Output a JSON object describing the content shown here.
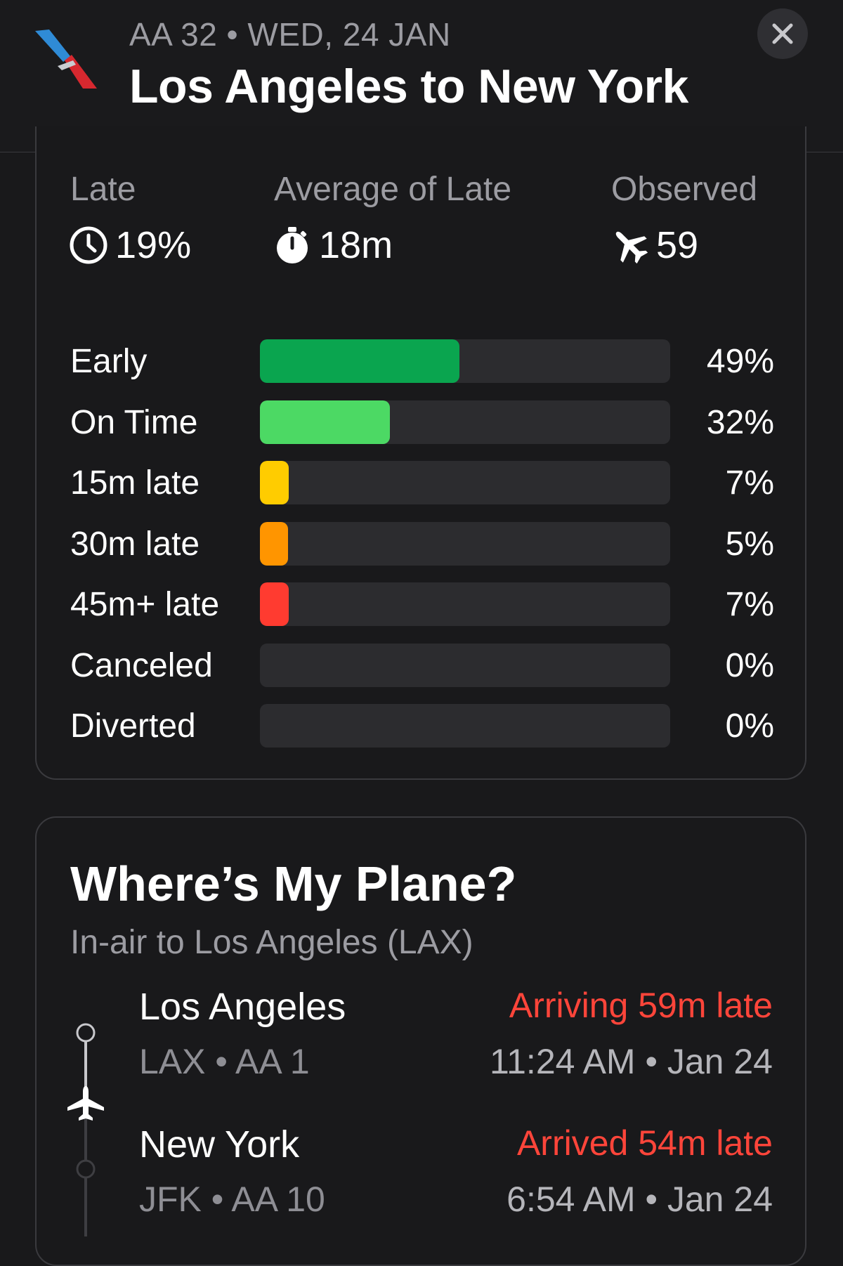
{
  "header": {
    "flight_line": "AA 32 • WED, 24 JAN",
    "route_title": "Los Angeles to New York",
    "close_icon": "close-icon"
  },
  "stats": {
    "late": {
      "label": "Late",
      "value": "19%",
      "icon": "clock-icon"
    },
    "avg_late": {
      "label": "Average of Late",
      "value": "18m",
      "icon": "stopwatch-icon"
    },
    "observed": {
      "label": "Observed",
      "value": "59",
      "icon": "plane-icon"
    }
  },
  "distribution": [
    {
      "label": "Early",
      "percent": "49%",
      "fraction": 0.49,
      "color": "#0aa54f"
    },
    {
      "label": "On Time",
      "percent": "32%",
      "fraction": 0.32,
      "color": "#4cd964"
    },
    {
      "label": "15m late",
      "percent": "7%",
      "fraction": 0.07,
      "color": "#ffcc00"
    },
    {
      "label": "30m late",
      "percent": "5%",
      "fraction": 0.05,
      "color": "#ff9500"
    },
    {
      "label": "45m+ late",
      "percent": "7%",
      "fraction": 0.07,
      "color": "#ff3b30"
    },
    {
      "label": "Canceled",
      "percent": "0%",
      "fraction": 0.0,
      "color": "#8e8e93"
    },
    {
      "label": "Diverted",
      "percent": "0%",
      "fraction": 0.0,
      "color": "#8e8e93"
    }
  ],
  "plane": {
    "title": "Where’s My Plane?",
    "subtitle": "In-air to Los Angeles (LAX)",
    "legs": [
      {
        "city": "Los Angeles",
        "code": "LAX • AA 1",
        "status": "Arriving 59m late",
        "time": "11:24 AM • Jan 24"
      },
      {
        "city": "New York",
        "code": "JFK • AA 10",
        "status": "Arrived 54m late",
        "time": "6:54 AM • Jan 24"
      }
    ]
  }
}
